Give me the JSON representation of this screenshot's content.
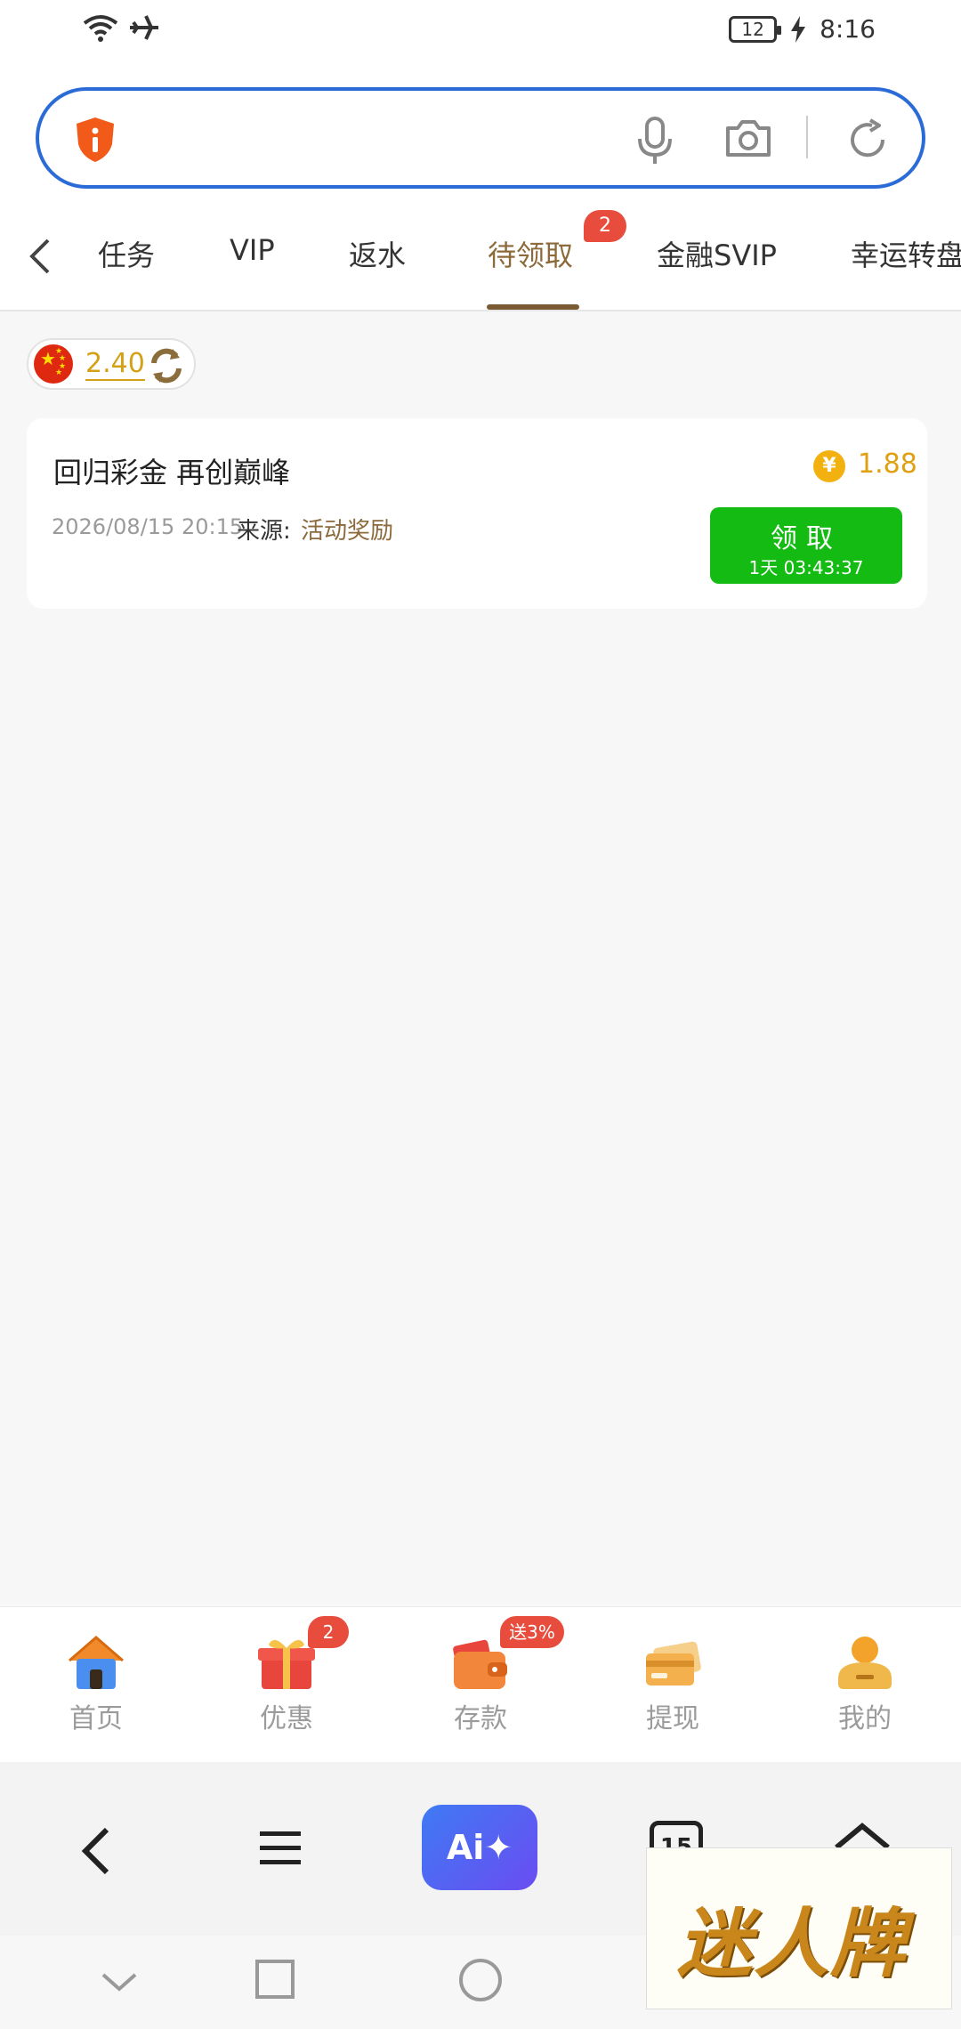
{
  "status_bar": {
    "time": "8:16",
    "battery": "12",
    "icons": [
      "wifi-icon",
      "airplane-icon",
      "battery-icon",
      "charging-icon"
    ]
  },
  "address_bar": {
    "icons": [
      "shield-icon",
      "mic-icon",
      "camera-icon",
      "refresh-icon"
    ],
    "colors": {
      "border": "#2b6bd8",
      "shield": "#f25a1a"
    }
  },
  "tabs": {
    "items": [
      {
        "label": "任务"
      },
      {
        "label": "VIP"
      },
      {
        "label": "返水"
      },
      {
        "label": "待领取",
        "active": true,
        "badge": "2"
      },
      {
        "label": "金融SVIP"
      },
      {
        "label": "幸运转盘"
      }
    ],
    "accent": "#8c6a3c"
  },
  "balance": {
    "value": "2.40"
  },
  "reward_card": {
    "title": "回归彩金 再创巅峰",
    "date": "2026/08/15 20:15",
    "source_label": "来源:",
    "source": "活动奖励",
    "currency_symbol": "¥",
    "amount": "1.88",
    "button_label": "领取",
    "button_timer": "1天 03:43:37",
    "button_color": "#13bb13"
  },
  "bottom_nav": {
    "items": [
      {
        "label": "首页",
        "icon": "house-icon"
      },
      {
        "label": "优惠",
        "icon": "gift-icon",
        "active": true,
        "badge": "2"
      },
      {
        "label": "存款",
        "icon": "wallet-icon",
        "badge": "送3%"
      },
      {
        "label": "提现",
        "icon": "card-icon"
      },
      {
        "label": "我的",
        "icon": "profile-icon"
      }
    ]
  },
  "browser_toolbar": {
    "ai_label": "Ai✦",
    "tabs_count": "15",
    "icons": [
      "back-icon",
      "menu-icon",
      "ai-icon",
      "tabs-icon",
      "home-icon"
    ]
  },
  "system_nav": {
    "icons": [
      "hide-icon",
      "recents-icon",
      "home-circle-icon"
    ]
  },
  "watermark": {
    "text": "迷人牌"
  }
}
